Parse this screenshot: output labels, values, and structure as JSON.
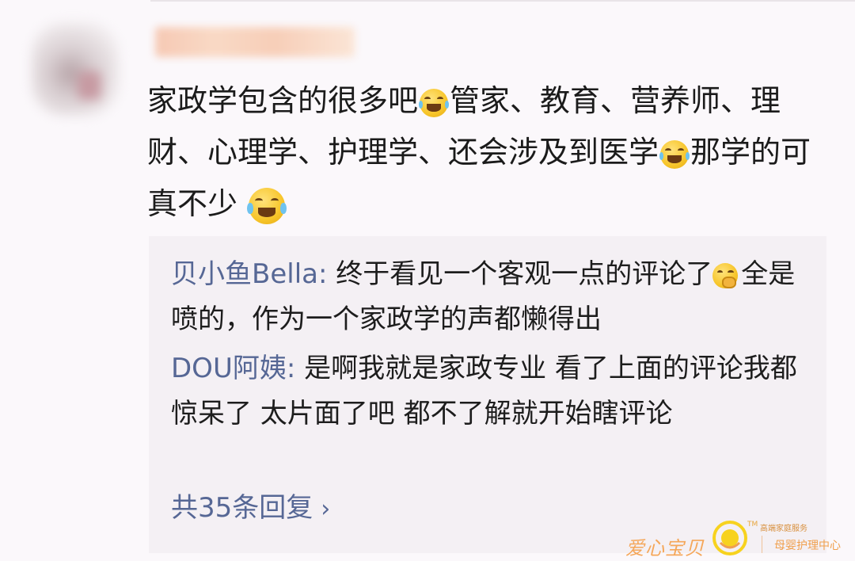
{
  "comment": {
    "author_blurred": true,
    "text_1": "家政学包含的很多吧",
    "emoji_1": "crying-laughing-emoji",
    "text_2": "管家、教育、营养师、理财、心理学、护理学、还会涉及到医学",
    "emoji_2": "crying-laughing-emoji",
    "text_3": "那学的可真不少",
    "emoji_3": "tears-of-joy-emoji"
  },
  "replies": [
    {
      "author": "贝小鱼Bella",
      "separator": ": ",
      "text_1": "终于看见一个客观一点的评论了",
      "emoji": "shushing-emoji",
      "text_2": "全是喷的，作为一个家政学的声都懒得出"
    },
    {
      "author": "DOU阿姨",
      "separator": ": ",
      "text": "是啊我就是家政专业 看了上面的评论我都惊呆了 太片面了吧 都不了解就开始瞎评论"
    }
  ],
  "more_replies": {
    "label": "共35条回复",
    "chevron": "›"
  },
  "watermark": {
    "brand": "爱心宝贝",
    "tm": "TM",
    "tagline": "高端家庭服务",
    "subtitle": "母婴护理中心",
    "logo_icon": "sun-logo-icon",
    "color": "#f5a75a"
  },
  "colors": {
    "background": "#fbf8fb",
    "reply_background": "#f4f0f4",
    "author_link": "#566795",
    "text": "#1b1b1b"
  }
}
